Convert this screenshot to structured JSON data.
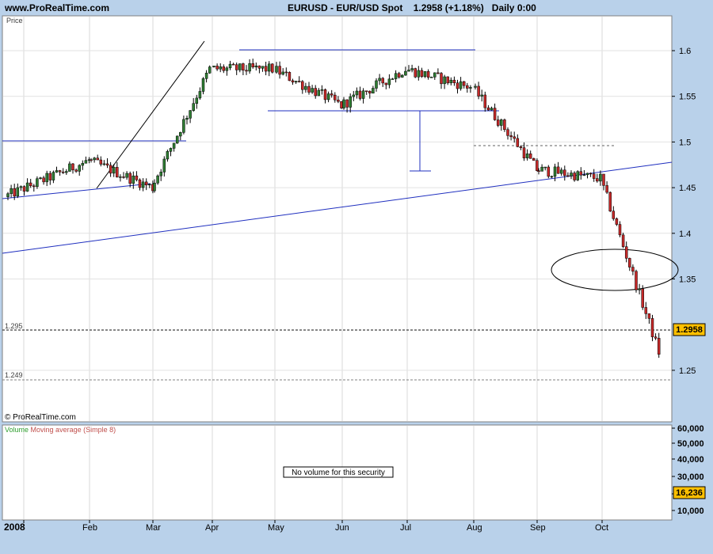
{
  "header": {
    "site": "www.ProRealTime.com",
    "symbol": "EURUSD - EUR/USD Spot",
    "last": "1.2958",
    "change": "(+1.18%)",
    "period": "Daily",
    "time": "0:00"
  },
  "price_panel": {
    "label": "Price",
    "copyright": "© ProRealTime.com",
    "current_price_badge": "1.2958",
    "left_level_labels": [
      "1.295",
      "1.249"
    ]
  },
  "volume_panel": {
    "legend_volume": "Volume",
    "legend_ma": "Moving average (Simple 8)",
    "no_volume_text": "No volume for this security",
    "current_badge": "16,236",
    "ticks": [
      "60,000",
      "50,000",
      "40,000",
      "30,000",
      "20,000",
      "10,000"
    ]
  },
  "colors": {
    "background": "#B9D1EA",
    "panel": "#FFFFFF",
    "bull": "#2E7D32",
    "bear": "#C62828",
    "trendline": "#1F2FBF",
    "volume_legend": "#2E9E2E",
    "ma_legend": "#C0504D",
    "badge": "#FFC000"
  },
  "chart_data": {
    "type": "candlestick",
    "instrument": "EURUSD",
    "y_ticks": [
      "1.6",
      "1.55",
      "1.5",
      "1.45",
      "1.4",
      "1.35",
      "1.25"
    ],
    "ylim": [
      1.23,
      1.63
    ],
    "x_ticks": [
      "2008",
      "Feb",
      "Mar",
      "Apr",
      "May",
      "Jun",
      "Jul",
      "Aug",
      "Sep",
      "Oct"
    ],
    "last_close": 1.2958,
    "change_pct": 1.18,
    "horizontal_levels": [
      {
        "value": 1.295,
        "label": "1.295",
        "style": "dashed"
      },
      {
        "value": 1.249,
        "label": "1.249",
        "style": "dashed"
      }
    ],
    "monthly_path": [
      {
        "month": "Jan",
        "start": 1.44,
        "end": 1.48
      },
      {
        "month": "Feb",
        "start": 1.48,
        "end": 1.45
      },
      {
        "month": "Mar",
        "start": 1.45,
        "end": 1.58
      },
      {
        "month": "Apr",
        "start": 1.58,
        "end": 1.58
      },
      {
        "month": "May",
        "start": 1.58,
        "end": 1.54
      },
      {
        "month": "Jun",
        "start": 1.54,
        "end": 1.58
      },
      {
        "month": "Jul",
        "start": 1.58,
        "end": 1.56
      },
      {
        "month": "Aug",
        "start": 1.56,
        "end": 1.47
      },
      {
        "month": "Sep",
        "start": 1.47,
        "end": 1.46
      },
      {
        "month": "Oct",
        "start": 1.46,
        "end": 1.27
      }
    ]
  }
}
